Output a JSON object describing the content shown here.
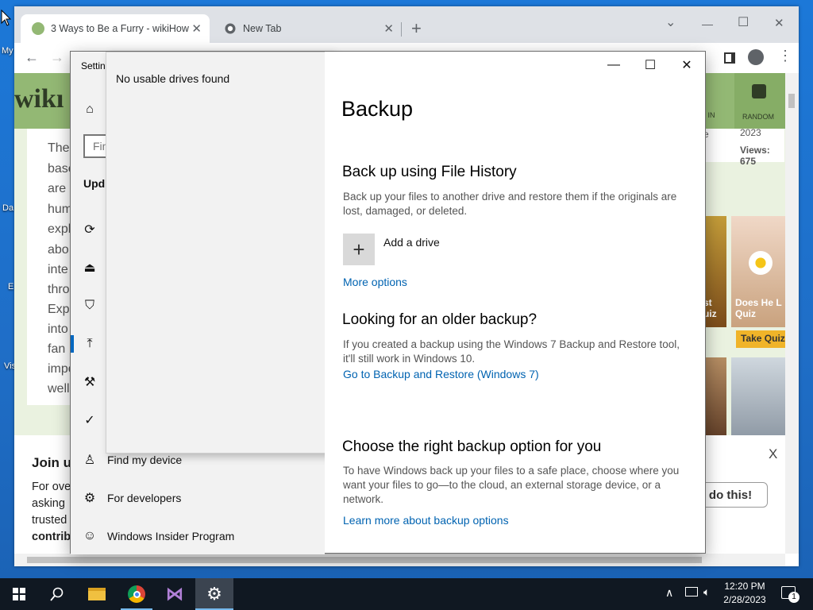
{
  "desktop": {
    "icons": [
      "My",
      "Da",
      "E",
      "Vis"
    ]
  },
  "browser": {
    "tabs": [
      {
        "title": "3 Ways to Be a Furry - wikiHow",
        "active": true
      },
      {
        "title": "New Tab",
        "active": false
      }
    ],
    "new_tab": "+",
    "window_controls": {
      "minimize": "—",
      "maximize": "☐",
      "close": "✕",
      "dropdown": "⌄"
    }
  },
  "page": {
    "logo": "wikı",
    "header_right": {
      "signin": "S IN",
      "random": "RANDOM"
    },
    "sidebar_card": {
      "year": "2023",
      "views": "Views: 675",
      "e": "e"
    },
    "article_lines": [
      "The",
      "base",
      "are",
      "hum",
      "expl",
      "abo",
      "inte",
      "thro",
      "Exp",
      "into",
      "fan",
      "impo",
      "well"
    ],
    "thumbs": [
      {
        "caption": "st\nuiz"
      },
      {
        "caption": "Does He L\nQuiz",
        "button": "Take Quiz"
      }
    ],
    "join": {
      "title": "Join u",
      "lines": [
        "For ove",
        "asking",
        "trusted",
        "contrib"
      ],
      "cta": "do this!",
      "close": "X"
    }
  },
  "settings": {
    "title": "Settin",
    "search_placeholder": "Fin",
    "category": "Upd",
    "flyout_message": "No usable drives found",
    "nav_items": [
      {
        "label": "Find my device",
        "icon": "find-device-icon"
      },
      {
        "label": "For developers",
        "icon": "developers-icon"
      },
      {
        "label": "Windows Insider Program",
        "icon": "insider-icon"
      }
    ],
    "page_title": "Backup",
    "file_history": {
      "heading": "Back up using File History",
      "desc": "Back up your files to another drive and restore them if the originals are lost, damaged, or deleted.",
      "add_drive": "Add a drive",
      "more_options": "More options"
    },
    "older": {
      "heading": "Looking for an older backup?",
      "desc": "If you created a backup using the Windows 7 Backup and Restore tool, it'll still work in Windows 10.",
      "link": "Go to Backup and Restore (Windows 7)"
    },
    "choose": {
      "heading": "Choose the right backup option for you",
      "desc": "To have Windows back up your files to a safe place, choose where you want your files to go—to the cloud, an external storage device, or a network.",
      "link": "Learn more about backup options"
    }
  },
  "taskbar": {
    "time": "12:20 PM",
    "date": "2/28/2023",
    "notif_count": "1"
  },
  "colors": {
    "accent": "#0063b1",
    "wikihow_green": "#93b874",
    "taskbar": "#101822"
  }
}
